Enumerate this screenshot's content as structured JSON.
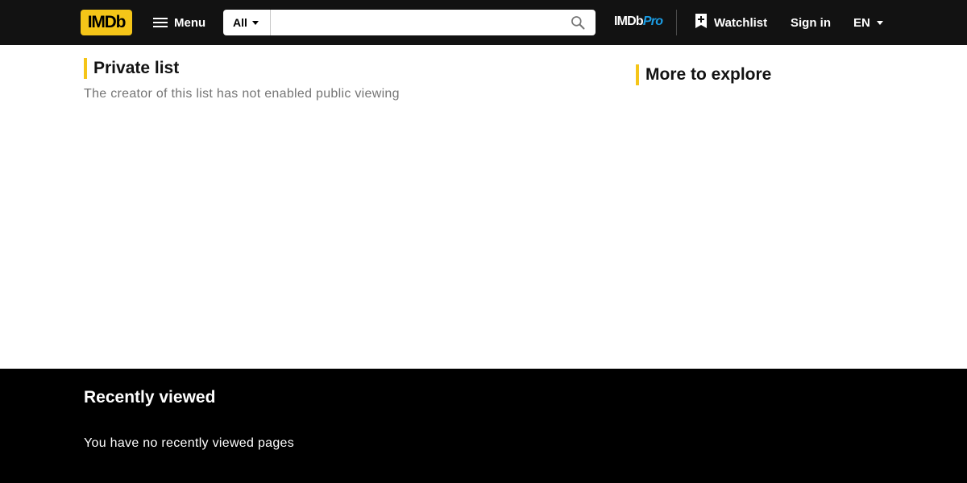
{
  "header": {
    "logo_text": "IMDb",
    "menu_label": "Menu",
    "search": {
      "category": "All",
      "value": "",
      "placeholder": ""
    },
    "imdbpro": {
      "part1": "IMDb",
      "part2": "Pro"
    },
    "watchlist_label": "Watchlist",
    "signin_label": "Sign in",
    "language": "EN"
  },
  "main": {
    "title": "Private list",
    "subtitle": "The creator of this list has not enabled public viewing"
  },
  "sidebar": {
    "title": "More to explore"
  },
  "recently_viewed": {
    "title": "Recently viewed",
    "empty_message": "You have no recently viewed pages"
  },
  "colors": {
    "brand_yellow": "#f5c518",
    "nav_bg": "#121212",
    "pro_blue": "#1b9ce3",
    "footer_bg": "#000000"
  },
  "icons": [
    "hamburger-menu-icon",
    "caret-down-icon",
    "search-icon",
    "watchlist-add-icon"
  ]
}
